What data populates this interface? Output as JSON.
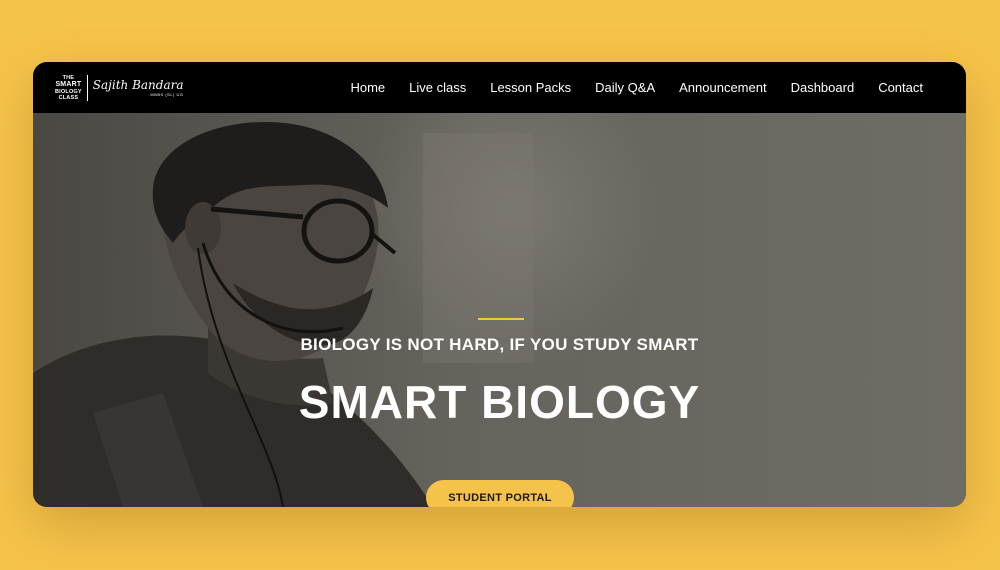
{
  "brand": {
    "logo_lines": [
      "THE",
      "SMART",
      "BIOLOGY",
      "CLASS"
    ],
    "signature": "Sajith Bandara",
    "signature_sub": "MBBS (SL) UG"
  },
  "nav": {
    "items": [
      {
        "label": "Home"
      },
      {
        "label": "Live class"
      },
      {
        "label": "Lesson Packs"
      },
      {
        "label": "Daily Q&A"
      },
      {
        "label": "Announcement"
      },
      {
        "label": "Dashboard"
      },
      {
        "label": "Contact"
      }
    ]
  },
  "hero": {
    "tagline": "BIOLOGY IS NOT HARD, IF YOU STUDY SMART",
    "title": "SMART BIOLOGY",
    "cta_label": "STUDENT PORTAL"
  },
  "colors": {
    "accent": "#f6c34a",
    "nav_bg": "#000000",
    "hero_overlay": "#6e6b64"
  }
}
